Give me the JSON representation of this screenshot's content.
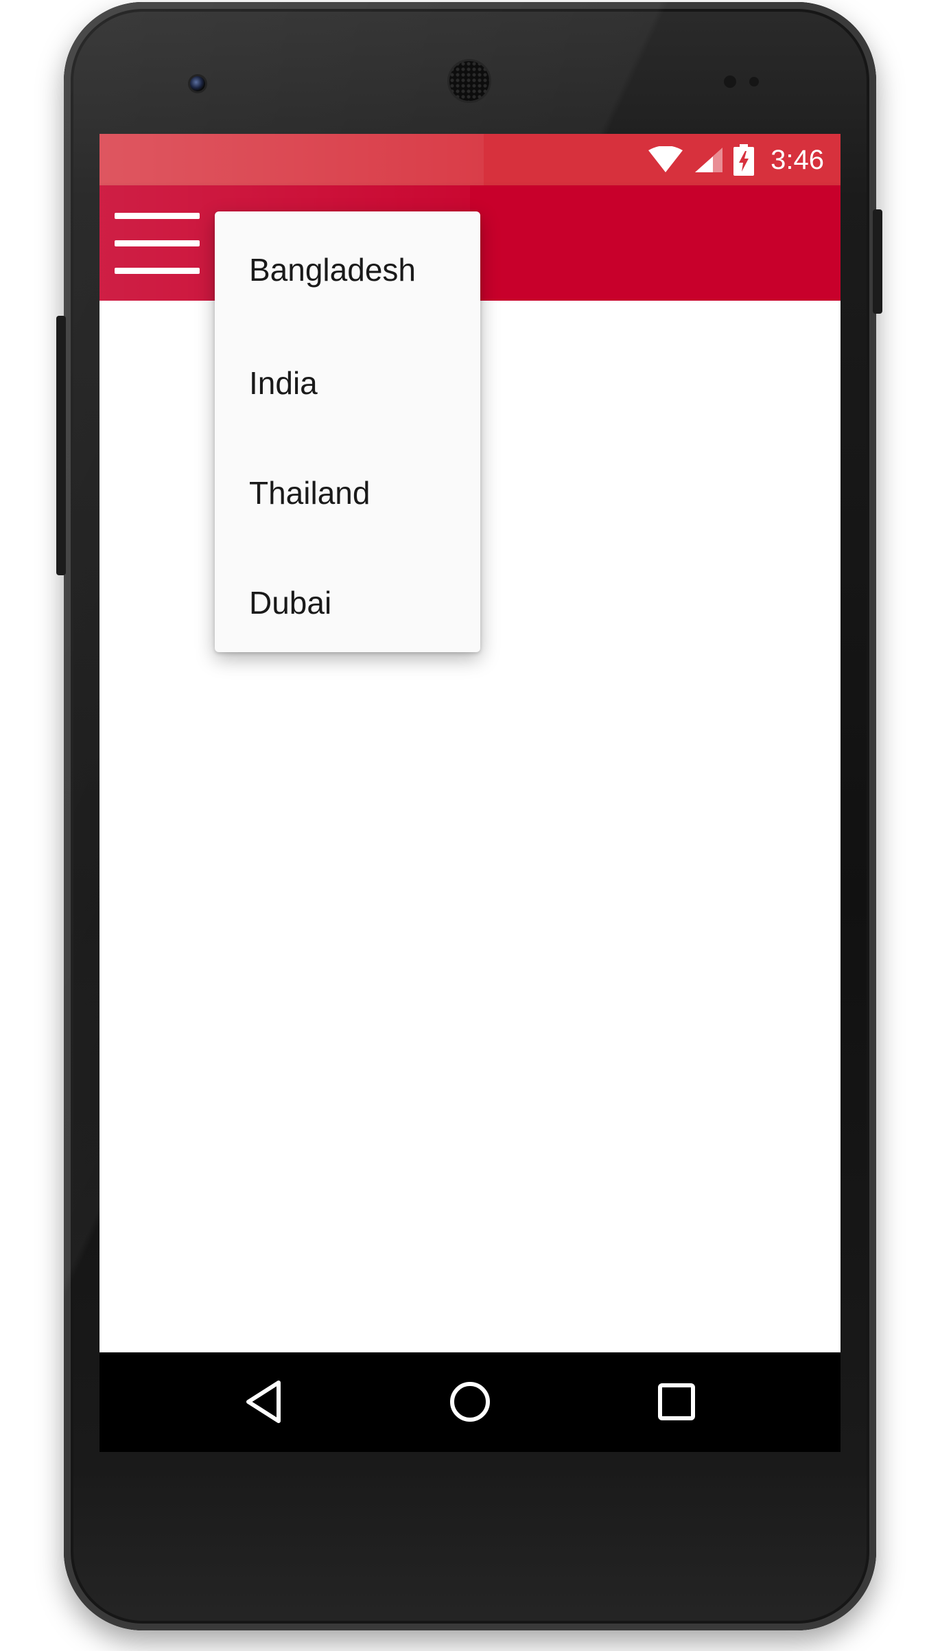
{
  "status_bar": {
    "time": "3:46",
    "icons": [
      "wifi-icon",
      "cell-signal-icon",
      "battery-charging-icon"
    ],
    "color": "#d7313d"
  },
  "toolbar": {
    "color": "#c8002b",
    "menu_icon": "hamburger-menu-icon"
  },
  "dropdown": {
    "items": [
      {
        "label": "Bangladesh"
      },
      {
        "label": "India"
      },
      {
        "label": "Thailand"
      },
      {
        "label": "Dubai"
      }
    ]
  },
  "nav_bar": {
    "buttons": [
      "back-icon",
      "home-icon",
      "recents-icon"
    ]
  }
}
